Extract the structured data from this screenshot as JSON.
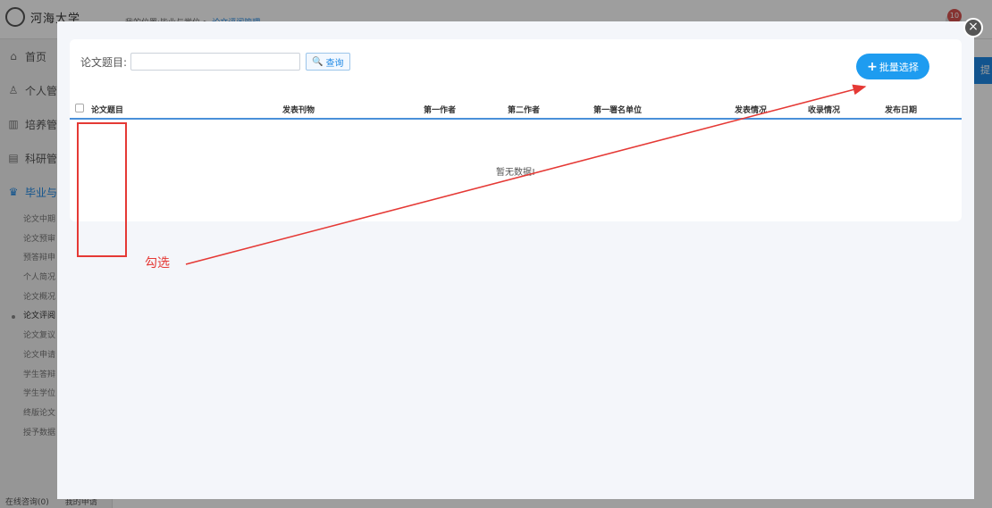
{
  "background": {
    "logo_text": "河海大学",
    "breadcrumb": "我的位置:毕业与学位 > ",
    "breadcrumb_current": "论文评阅管理",
    "notification_count": "10",
    "right_button_label": "提交",
    "nav": [
      {
        "icon": "home-icon",
        "glyph": "⌂",
        "label": "首页"
      },
      {
        "icon": "user-icon",
        "glyph": "♙",
        "label": "个人管理"
      },
      {
        "icon": "chart-icon",
        "glyph": "▥",
        "label": "培养管理"
      },
      {
        "icon": "research-icon",
        "glyph": "▤",
        "label": "科研管理"
      },
      {
        "icon": "graduation-icon",
        "glyph": "♛",
        "label": "毕业与学位"
      }
    ],
    "subnav": [
      "论文中期",
      "论文预审",
      "预答辩申",
      "个人简况",
      "论文概况",
      "论文评阅",
      "论文复议",
      "论文申请",
      "学生答辩",
      "学生学位",
      "终版论文",
      "授予数据"
    ],
    "footer": [
      "在线咨询(0)",
      "我的申请"
    ]
  },
  "modal": {
    "search_label": "论文题目:",
    "search_placeholder": "",
    "search_button": "查询",
    "batch_button": "批量选择",
    "columns": [
      "论文题目",
      "发表刊物",
      "第一作者",
      "第二作者",
      "第一署名单位",
      "发表情况",
      "收录情况",
      "发布日期"
    ],
    "empty_text": "暂无数据!"
  },
  "annotation": {
    "label": "勾选",
    "color": "#e53935"
  },
  "colors": {
    "accent": "#1e9cf0",
    "header_border": "#4a90d9"
  }
}
